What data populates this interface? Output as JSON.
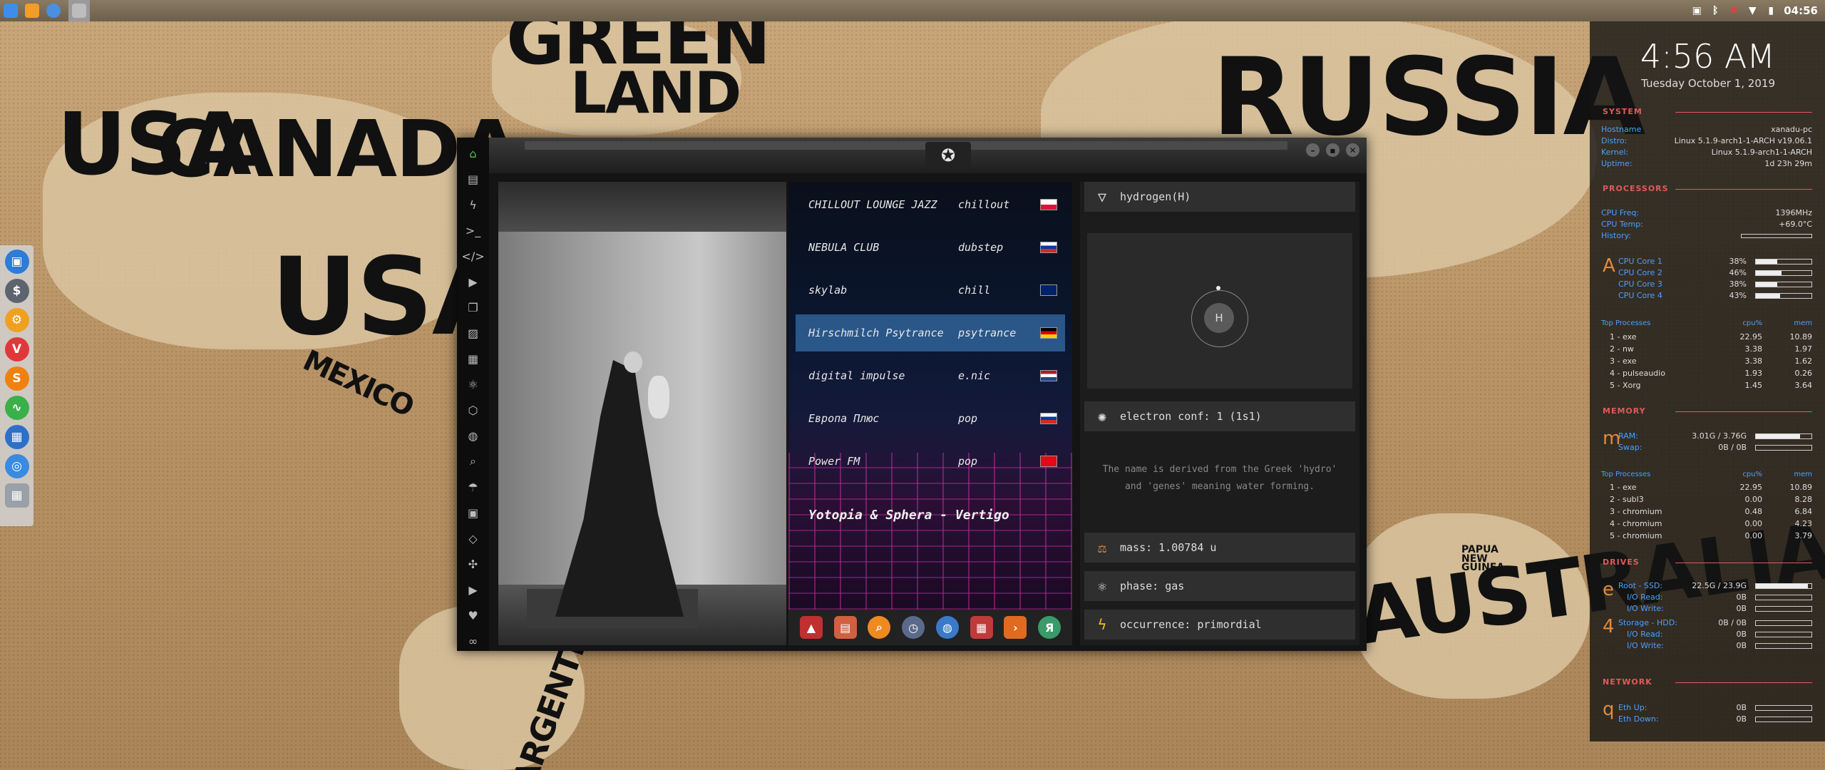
{
  "wallpaper": {
    "labels": [
      "GREEN",
      "LAND",
      "USA",
      "CANADA",
      "MEXICO",
      "RUSSIA",
      "AUSTRALIA",
      "PAPUA NEW GUINEA",
      "ARGENTINA"
    ]
  },
  "top_panel": {
    "launchers": [
      {
        "icon": "file-manager-icon",
        "color": "#3d8ee8"
      },
      {
        "icon": "sublime-text-icon",
        "color": "#f29d26"
      },
      {
        "icon": "chromium-icon",
        "color": "#4a8fe0"
      },
      {
        "icon": "window-placeholder-icon",
        "color": "#9a9a9a"
      }
    ],
    "tray": [
      "image-viewer-icon",
      "bluetooth-icon",
      "bug-icon",
      "wifi-icon",
      "battery-icon"
    ],
    "time": "04:56"
  },
  "dock": {
    "apps": [
      {
        "icon": "files-icon",
        "glyph": "▣",
        "color": "#2d7cd6"
      },
      {
        "icon": "money-icon",
        "glyph": "$",
        "color": "#5d6470"
      },
      {
        "icon": "settings-icon",
        "glyph": "⚙",
        "color": "#f0a020"
      },
      {
        "icon": "vivaldi-icon",
        "glyph": "V",
        "color": "#e0383a"
      },
      {
        "icon": "s-app-icon",
        "glyph": "S",
        "color": "#f08010"
      },
      {
        "icon": "activity-icon",
        "glyph": "∿",
        "color": "#3ab04a"
      },
      {
        "icon": "display-icon",
        "glyph": "▦",
        "color": "#2d70c8"
      },
      {
        "icon": "chrome-icon",
        "glyph": "◎",
        "color": "#3a8ae0"
      },
      {
        "icon": "workspace-icon",
        "glyph": "▦",
        "color": "#9aa0a8"
      }
    ]
  },
  "window": {
    "sidebar": [
      "home-icon",
      "document-icon",
      "lightning-icon",
      "terminal-icon",
      "code-icon",
      "play-icon",
      "image-stack-icon",
      "image-icon",
      "news-icon",
      "atom-icon",
      "hexagon-icon",
      "globe-icon",
      "search-icon",
      "umbrella-icon",
      "contact-icon",
      "diamond-code-icon",
      "expand-icon",
      "youtube-icon",
      "heart-icon",
      "infinity-icon"
    ],
    "emblem": "rebel-alliance-icon",
    "radio": {
      "stations": [
        {
          "name": "CHILLOUT LOUNGE JAZZ",
          "genre": "chillout",
          "flag": "poland"
        },
        {
          "name": "NEBULA CLUB",
          "genre": "dubstep",
          "flag": "russia"
        },
        {
          "name": "skylab",
          "genre": "chill",
          "flag": "uk"
        },
        {
          "name": "Hirschmilch Psytrance",
          "genre": "psytrance",
          "flag": "germany",
          "selected": true
        },
        {
          "name": "digital impulse",
          "genre": "e.nic",
          "flag": "netherlands"
        },
        {
          "name": "Европа Плюс",
          "genre": "pop",
          "flag": "russia"
        },
        {
          "name": "Power FM",
          "genre": "pop",
          "flag": "turkey"
        }
      ],
      "now_playing": "Yotopia & Sphera - Vertigo",
      "dock": [
        {
          "icon": "arch-icon",
          "glyph": "▲",
          "color": "#c03030"
        },
        {
          "icon": "notes-icon",
          "glyph": "▤",
          "color": "#d06040"
        },
        {
          "icon": "search-app-icon",
          "glyph": "⌕",
          "color": "#f08a20"
        },
        {
          "icon": "clock-app-icon",
          "glyph": "◷",
          "color": "#5a6a8a"
        },
        {
          "icon": "web-icon",
          "glyph": "◍",
          "color": "#3a7ac8"
        },
        {
          "icon": "calendar-icon",
          "glyph": "▦",
          "color": "#c03a3a"
        },
        {
          "icon": "arrow-app-icon",
          "glyph": "›",
          "color": "#e06a20"
        },
        {
          "icon": "yandex-icon",
          "glyph": "Я",
          "color": "#3a9a6a"
        }
      ]
    },
    "element": {
      "name": "hydrogen(H)",
      "symbol": "H",
      "electron_conf": "electron conf: 1 (1s1)",
      "description": "The name is derived from the Greek 'hydro' and 'genes' meaning water forming.",
      "mass": "mass: 1.00784 u",
      "phase": "phase: gas",
      "occurrence": "occurrence: primordial",
      "close": "×"
    }
  },
  "conky": {
    "time": "4:56 AM",
    "date": "Tuesday October 1, 2019",
    "system": {
      "header": "SYSTEM",
      "rows": [
        {
          "k": "Hostname",
          "v": "xanadu-pc"
        },
        {
          "k": "Distro:",
          "v": "Linux 5.1.9-arch1-1-ARCH v19.06.1"
        },
        {
          "k": "Kernel:",
          "v": "Linux 5.1.9-arch1-1-ARCH"
        },
        {
          "k": "Uptime:",
          "v": "1d 23h 29m"
        }
      ]
    },
    "processors": {
      "header": "PROCESSORS",
      "freq": {
        "k": "CPU Freq:",
        "v": "1396MHz"
      },
      "temp": {
        "k": "CPU Temp:",
        "v": "+69.0°C"
      },
      "history": "History:",
      "letter": "A",
      "cores": [
        {
          "k": "CPU Core 1",
          "v": "38%",
          "pct": 38
        },
        {
          "k": "CPU Core 2",
          "v": "46%",
          "pct": 46
        },
        {
          "k": "CPU Core 3",
          "v": "38%",
          "pct": 38
        },
        {
          "k": "CPU Core 4",
          "v": "43%",
          "pct": 43
        }
      ],
      "top_header": {
        "name": "Top Processes",
        "cpu": "cpu%",
        "mem": "mem"
      },
      "top": [
        {
          "n": "1 - exe",
          "c": "22.95",
          "m": "10.89"
        },
        {
          "n": "2 - nw",
          "c": "3.38",
          "m": "1.97"
        },
        {
          "n": "3 - exe",
          "c": "3.38",
          "m": "1.62"
        },
        {
          "n": "4 - pulseaudio",
          "c": "1.93",
          "m": "0.26"
        },
        {
          "n": "5 - Xorg",
          "c": "1.45",
          "m": "3.64"
        }
      ]
    },
    "memory": {
      "header": "MEMORY",
      "letter": "m",
      "ram": {
        "k": "RAM:",
        "v": "3.01G / 3.76G",
        "pct": 80
      },
      "swap": {
        "k": "Swap:",
        "v": "0B / 0B",
        "pct": 0
      },
      "top_header": {
        "name": "Top Processes",
        "cpu": "cpu%",
        "mem": "mem"
      },
      "top": [
        {
          "n": "1 - exe",
          "c": "22.95",
          "m": "10.89"
        },
        {
          "n": "2 - subl3",
          "c": "0.00",
          "m": "8.28"
        },
        {
          "n": "3 - chromium",
          "c": "0.48",
          "m": "6.84"
        },
        {
          "n": "4 - chromium",
          "c": "0.00",
          "m": "4.23"
        },
        {
          "n": "5 - chromium",
          "c": "0.00",
          "m": "3.79"
        }
      ]
    },
    "drives": {
      "header": "DRIVES",
      "d1": {
        "letter": "e",
        "k": "Root - SSD:",
        "v": "22.5G / 23.9G",
        "pct": 94,
        "read_k": "I/O Read:",
        "read_v": "0B",
        "write_k": "I/O Write:",
        "write_v": "0B"
      },
      "d2": {
        "letter": "4",
        "k": "Storage - HDD:",
        "v": "0B / 0B",
        "pct": 0,
        "read_k": "I/O Read:",
        "read_v": "0B",
        "write_k": "I/O Write:",
        "write_v": "0B"
      }
    },
    "network": {
      "header": "NETWORK",
      "letter": "q",
      "up": {
        "k": "Eth Up:",
        "v": "0B"
      },
      "down": {
        "k": "Eth Down:",
        "v": "0B"
      }
    }
  }
}
